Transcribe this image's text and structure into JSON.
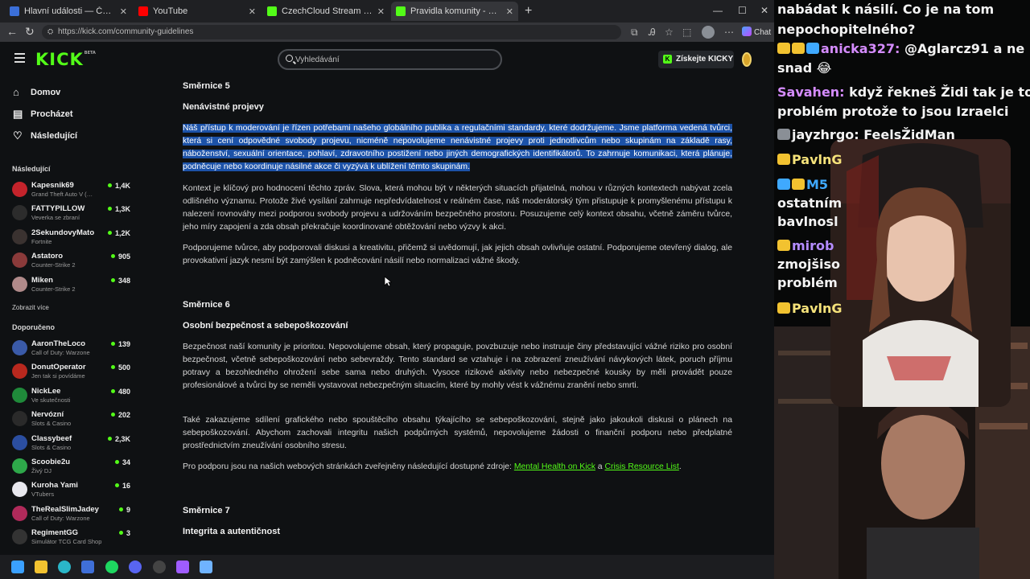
{
  "browser": {
    "tabs": [
      {
        "title": "Hlavní události — ČT24 — Česká t",
        "active": false,
        "favicon_color": "#3b6fd8"
      },
      {
        "title": "YouTube",
        "active": false,
        "favicon_color": "#ff0000"
      },
      {
        "title": "CzechCloud Stream - Watch Live o",
        "active": false,
        "favicon_color": "#53fc18"
      },
      {
        "title": "Pravidla komunity - Kick Streaming",
        "active": true,
        "favicon_color": "#53fc18"
      }
    ],
    "url": "https://kick.com/community-guidelines",
    "chat_button": "Chat"
  },
  "kick": {
    "logo": "KICK",
    "logo_beta": "BETA",
    "search_placeholder": "Vyhledávání",
    "get_kicky": "Získejte KICKY",
    "accent": "#53fc18"
  },
  "sidebar": {
    "nav": [
      {
        "label": "Domov",
        "icon": "home-icon"
      },
      {
        "label": "Procházet",
        "icon": "browse-icon"
      },
      {
        "label": "Následující",
        "icon": "heart-icon"
      }
    ],
    "following_title": "Následující",
    "following": [
      {
        "name": "Kapesnik69",
        "game": "Grand Theft Auto V (…",
        "viewers": "1,4K",
        "color": "#c4232b"
      },
      {
        "name": "FATTYPILLOW",
        "game": "Veverka se zbraní",
        "viewers": "1,3K",
        "color": "#2c2c2c"
      },
      {
        "name": "2SekundovyMato",
        "game": "Fortnite",
        "viewers": "1,2K",
        "color": "#3a3230"
      },
      {
        "name": "Astatoro",
        "game": "Counter-Strike 2",
        "viewers": "905",
        "color": "#8a3a3a"
      },
      {
        "name": "Miken",
        "game": "Counter-Strike 2",
        "viewers": "348",
        "color": "#b08a8a"
      }
    ],
    "show_more": "Zobrazit více",
    "recommended_title": "Doporučeno",
    "recommended": [
      {
        "name": "AaronTheLoco",
        "game": "Call of Duty: Warzone",
        "viewers": "139",
        "color": "#3a5aa8"
      },
      {
        "name": "DonutOperator",
        "game": "Jen tak si povídáme",
        "viewers": "500",
        "color": "#b8281e"
      },
      {
        "name": "NickLee",
        "game": "Ve skutečnosti",
        "viewers": "480",
        "color": "#1f8a3a"
      },
      {
        "name": "Nervózní",
        "game": "Slots & Casino",
        "viewers": "202",
        "color": "#2a2a2a"
      },
      {
        "name": "Classybeef",
        "game": "Slots & Casino",
        "viewers": "2,3K",
        "color": "#2b4ea0"
      },
      {
        "name": "Scoobie2u",
        "game": "Živý DJ",
        "viewers": "34",
        "color": "#2ea84a"
      },
      {
        "name": "Kuroha Yami",
        "game": "VTubers",
        "viewers": "16",
        "color": "#e8e8ee"
      },
      {
        "name": "TheRealSlimJadey",
        "game": "Call of Duty: Warzone",
        "viewers": "9",
        "color": "#b02a5a"
      },
      {
        "name": "RegimentGG",
        "game": "Simulátor TCG Card Shop",
        "viewers": "3",
        "color": "#333333"
      }
    ]
  },
  "content": {
    "s5_heading": "Směrnice 5",
    "s5_title": "Nenávistné projevy",
    "s5_p1": "Náš přístup k moderování je řízen potřebami našeho globálního publika a regulačními standardy, které dodržujeme. Jsme platforma vedená tvůrci, která si cení odpovědné svobody projevu, nicméně nepovolujeme nenávistné projevy proti jednotlivcům nebo skupinám na základě rasy, náboženství, sexuální orientace, pohlaví, zdravotního postižení nebo jiných demografických identifikátorů. To zahrnuje komunikaci, která plánuje, podněcuje nebo koordinuje násilné akce či vyzývá k ublížení těmto skupinám.",
    "s5_p2": "Kontext je klíčový pro hodnocení těchto zpráv. Slova, která mohou být v některých situacích přijatelná, mohou v různých kontextech nabývat zcela odlišného významu. Protože živé vysílání zahrnuje nepředvídatelnost v reálném čase, náš moderátorský tým přistupuje k promyšlenému přístupu k nalezení rovnováhy mezi podporou svobody projevu a udržováním bezpečného prostoru. Posuzujeme celý kontext obsahu, včetně záměru tvůrce, jeho míry zapojení a zda obsah překračuje koordinované obtěžování nebo výzvy k akci.",
    "s5_p3": "Podporujeme tvůrce, aby podporovali diskusi a kreativitu, přičemž si uvědomují, jak jejich obsah ovlivňuje ostatní. Podporujeme otevřený dialog, ale provokativní jazyk nesmí být zamýšlen k podněcování násilí nebo normalizaci vážné škody.",
    "s6_heading": "Směrnice 6",
    "s6_title": "Osobní bezpečnost a sebepoškozování",
    "s6_p1": "Bezpečnost naší komunity je prioritou. Nepovolujeme obsah, který propaguje, povzbuzuje nebo instruuje činy představující vážné riziko pro osobní bezpečnost, včetně sebepoškozování nebo sebevraždy. Tento standard se vztahuje i na zobrazení zneužívání návykových látek, poruch příjmu potravy a bezohledného ohrožení sebe sama nebo druhých. Vysoce rizikové aktivity nebo nebezpečné kousky by měli provádět pouze profesionálové a tvůrci by se neměli vystavovat nebezpečným situacím, které by mohly vést k vážnému zranění nebo smrti.",
    "s6_p2": "Také zakazujeme sdílení grafického nebo spouštěcího obsahu týkajícího se sebepoškozování, stejně jako jakoukoli diskusi o plánech na sebepoškozování. Abychom zachovali integritu našich podpůrných systémů, nepovolujeme žádosti o finanční podporu nebo předplatné prostřednictvím zneužívání osobního stresu.",
    "s6_p3_pre": "Pro podporu jsou na našich webových stránkách zveřejněny následující dostupné zdroje: ",
    "s6_link1": "Mental Health on Kick",
    "s6_p3_mid": " a ",
    "s6_link2": "Crisis Resource List",
    "s6_p3_post": ".",
    "s7_heading": "Směrnice 7",
    "s7_title": "Integrita a autentičnost"
  },
  "chat": {
    "messages": [
      {
        "user": "",
        "text": "nabádat k násilí. Co je na tom",
        "user_color": "#f3f3f3"
      },
      {
        "user": "",
        "text": "nepochopitelného?",
        "user_color": "#f3f3f3"
      },
      {
        "user": "anicka327:",
        "text": " @Aglarcz91 a ne",
        "user_color": "#d58cff"
      },
      {
        "user": "",
        "text": "snad 😂",
        "user_color": "#f3f3f3"
      },
      {
        "user": "Savahen:",
        "text": " když řekneš Židi tak je to",
        "user_color": "#d58cff"
      },
      {
        "user": "",
        "text": "problém protože to jsou Izraelci",
        "user_color": "#f3f3f3"
      },
      {
        "user": "jayzhrgo:",
        "text": " FeelsŽidMan",
        "user_color": "#f3f3f3"
      },
      {
        "user": "PavlnG",
        "text": "",
        "user_color": "#f5e27a"
      },
      {
        "user": "M5",
        "text": "",
        "user_color": "#3fa9ff"
      },
      {
        "user": "",
        "text": "ostatním",
        "user_color": "#f3f3f3"
      },
      {
        "user": "",
        "text": "bavlnosl",
        "user_color": "#f3f3f3"
      },
      {
        "user": "mirob",
        "text": "",
        "user_color": "#b48cff"
      },
      {
        "user": "",
        "text": "zmojšiso",
        "user_color": "#f3f3f3"
      },
      {
        "user": "",
        "text": "problém",
        "user_color": "#f3f3f3"
      },
      {
        "user": "PavlnG",
        "text": "",
        "user_color": "#f5e27a"
      }
    ]
  }
}
